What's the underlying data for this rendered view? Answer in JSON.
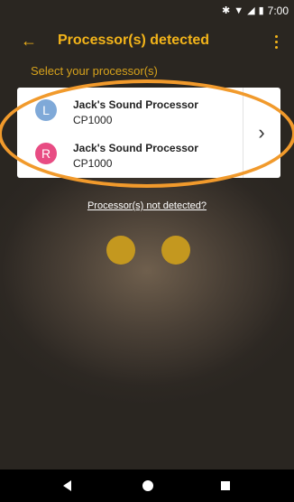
{
  "status_bar": {
    "bluetooth_icon": "bluetooth-icon",
    "wifi_icon": "wifi-icon",
    "signal_icon": "signal-icon",
    "battery_icon": "battery-icon",
    "time": "7:00"
  },
  "app_bar": {
    "title": "Processor(s) detected",
    "back_icon": "arrow-left-icon",
    "menu_icon": "more-vert-icon"
  },
  "subtitle": "Select your processor(s)",
  "processors": [
    {
      "side": "L",
      "name": "Jack's Sound Processor",
      "model": "CP1000",
      "color": "#7fa9d8"
    },
    {
      "side": "R",
      "name": "Jack's Sound Processor",
      "model": "CP1000",
      "color": "#e84c83"
    }
  ],
  "not_detected_link": "Processor(s) not detected?",
  "colors": {
    "accent": "#f3b41a",
    "highlight_ring": "#f19a2c",
    "dot": "#c4981f"
  },
  "nav_bar": {
    "back_icon": "nav-back-icon",
    "home_icon": "nav-home-icon",
    "recent_icon": "nav-recent-icon"
  }
}
